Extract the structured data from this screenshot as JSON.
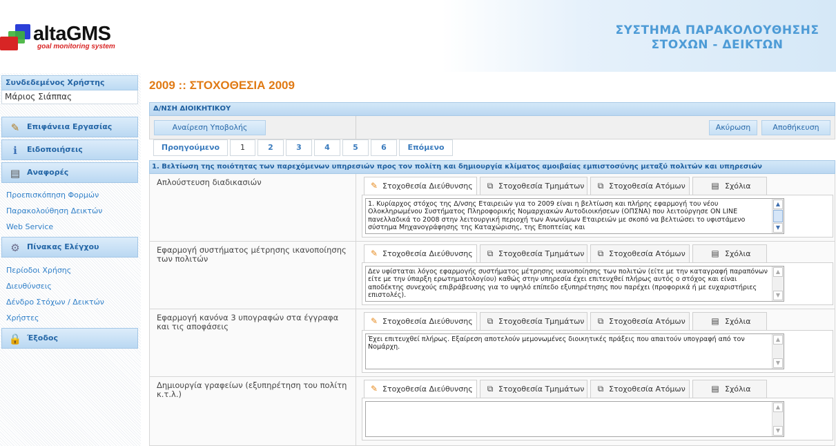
{
  "header": {
    "logo_name": "altaGMS",
    "logo_tagline": "goal monitoring system",
    "system_title_line1": "ΣΥΣΤΗΜΑ ΠΑΡΑΚΟΛΟΥΘΗΣΗΣ",
    "system_title_line2": "ΣΤΟΧΩΝ - ΔΕΙΚΤΩΝ"
  },
  "sidebar": {
    "user_heading": "Συνδεδεμένος Χρήστης",
    "user_name": "Μάριος Σιάππας",
    "menu": [
      {
        "label": "Επιφάνεια Εργασίας",
        "icon": "desktop-icon"
      },
      {
        "label": "Ειδοποιήσεις",
        "icon": "notifications-icon"
      },
      {
        "label": "Αναφορές",
        "icon": "reports-icon"
      },
      {
        "label": "Πίνακας Ελέγχου",
        "icon": "gears-icon"
      },
      {
        "label": "Έξοδος",
        "icon": "lock-icon"
      }
    ],
    "reports_links": [
      "Προεπισκόπηση Φορμών",
      "Παρακολούθηση Δεικτών",
      "Web Service"
    ],
    "control_links": [
      "Περίοδοι Χρήσης",
      "Διευθύνσεις",
      "Δένδρο Στόχων / Δεικτών",
      "Χρήστες"
    ]
  },
  "main": {
    "page_title": "2009 :: ΣΤΟΧΟΘΕΣΙΑ 2009",
    "department": "Δ/ΝΣΗ ΔΙΟΙΚΗΤΙΚΟΥ",
    "remove_submission": "Αναίρεση Υποβολής",
    "cancel": "Ακύρωση",
    "save": "Αποθήκευση",
    "pager": {
      "previous": "Προηγούμενο",
      "pages": [
        "1",
        "2",
        "3",
        "4",
        "5",
        "6"
      ],
      "next": "Επόμενο"
    },
    "goal_title": "1. Βελτίωση της ποιότητας των παρεχόμενων υπηρεσιών προς τον πολίτη και δημιουργία κλίματος αμοιβαίας εμπιστοσύνης μεταξύ πολιτών και υπηρεσιών",
    "tabs": [
      "Στοχοθεσία Διεύθυνσης",
      "Στοχοθεσία Τμημάτων",
      "Στοχοθεσία Ατόμων",
      "Σχόλια"
    ],
    "rows": [
      {
        "label": "Απλούστευση διαδικασιών",
        "text": "1. Κυρίαρχος στόχος της Δ/νσης Εταιρειών για το 2009 είναι η βελτίωση και πλήρης εφαρμογή του νέου Ολοκληρωμένου Συστήματος Πληροφορικής Νομαρχιακών Αυτοδιοικήσεων (ΟΠΣΝΑ) που λειτούργησε ON LINE πανελλαδικά το 2008 στην λειτουργική περιοχή των Ανωνύμων Εταιρειών με σκοπό να βελτιώσει το υφιστάμενο σύστημα Μηχανογράφησης της Καταχώρισης, της Εποπτείας και"
      },
      {
        "label": "Εφαρμογή συστήματος μέτρησης ικανοποίησης των πολιτών",
        "text": "Δεν υφίσταται λόγος εφαρμογής συστήματος μέτρησης ικανοποίησης των πολιτών (είτε με την καταγραφή παραπόνων είτε με την ύπαρξη ερωτηματολογίου) καθώς στην υπηρεσία έχει επιτευχθεί πλήρως αυτός ο στόχος και είναι αποδέκτης συνεχούς επιβράβευσης για το υψηλό επίπεδο εξυπηρέτησης που παρέχει (προφορικά ή με ευχαριστήριες επιστολές)."
      },
      {
        "label": "Εφαρμογή κανόνα 3 υπογραφών στα έγγραφα και τις αποφάσεις",
        "text": "Έχει επιτευχθεί πλήρως. Εξαίρεση αποτελούν μεμονωμένες διοικητικές πράξεις που απαιτούν υπογραφή από τον Νομάρχη."
      },
      {
        "label": "Δημιουργία γραφείων (εξυπηρέτηση του πολίτη κ.τ.λ.)",
        "text": ""
      }
    ]
  }
}
